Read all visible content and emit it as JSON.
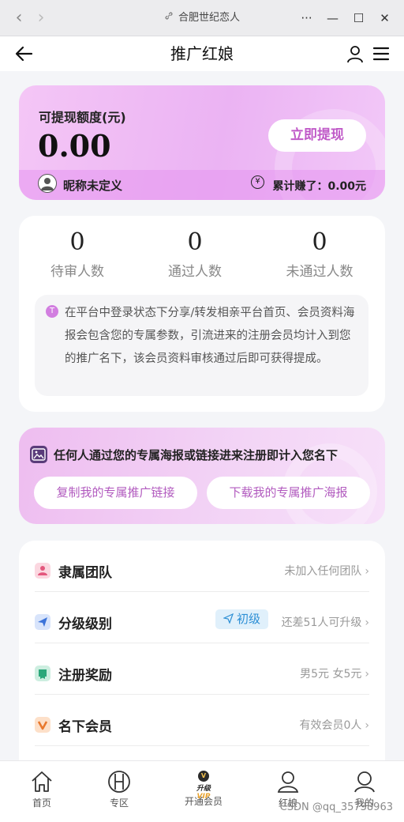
{
  "browser": {
    "title": "合肥世纪恋人",
    "more": "···",
    "minimize": "—",
    "maximize": "☐",
    "close": "✕",
    "back": "‹",
    "forward": "›"
  },
  "header": {
    "title": "推广红娘"
  },
  "balance": {
    "label": "可提现额度(元)",
    "amount": "0.00",
    "withdraw_button": "立即提现",
    "nickname": "昵称未定义",
    "coin_symbol": "¥",
    "earned_text": "累计赚了：0.00元"
  },
  "stats": [
    {
      "value": "0",
      "label": "待审人数"
    },
    {
      "value": "0",
      "label": "通过人数"
    },
    {
      "value": "0",
      "label": "未通过人数"
    }
  ],
  "notice": {
    "icon_glyph": "T",
    "text": "在平台中登录状态下分享/转发相亲平台首页、会员资料海报会包含您的专属参数，引流进来的注册会员均计入到您的推广名下，该会员资料审核通过后即可获得提成。"
  },
  "promo": {
    "headline": "任何人通过您的专属海报或链接进来注册即计入您名下",
    "copy_link_button": "复制我的专属推广链接",
    "download_poster_button": "下载我的专属推广海报"
  },
  "list": {
    "team": {
      "label": "隶属团队",
      "value": "未加入任何团队"
    },
    "level": {
      "label": "分级级别",
      "badge": "初级",
      "value": "还差51人可升级"
    },
    "reward": {
      "label": "注册奖励",
      "value": "男5元 女5元"
    },
    "members": {
      "label": "名下会员",
      "value": "有效会员0人"
    },
    "chevron": "›"
  },
  "tabbar": {
    "home": "首页",
    "zone": "专区",
    "vip": "开通会员",
    "vip_badge_text": "升级",
    "vip_badge_accent": "VIP",
    "vip_badge_glyph": "V",
    "matchmaker": "红娘",
    "mine": "我的"
  },
  "watermark": "CSDN @qq_35738963",
  "colors": {
    "accent": "#c05ac8",
    "card_pink": "#ebb3f3",
    "badge_blue": "#2d8fd5"
  },
  "icons": [
    "link-icon",
    "back-arrow-icon",
    "user-icon",
    "menu-icon",
    "avatar-icon",
    "coin-icon",
    "tip-icon",
    "image-icon",
    "team-icon",
    "send-icon",
    "reward-icon",
    "vip-icon",
    "home-icon",
    "zone-icon",
    "matchmaker-icon",
    "mine-icon"
  ]
}
